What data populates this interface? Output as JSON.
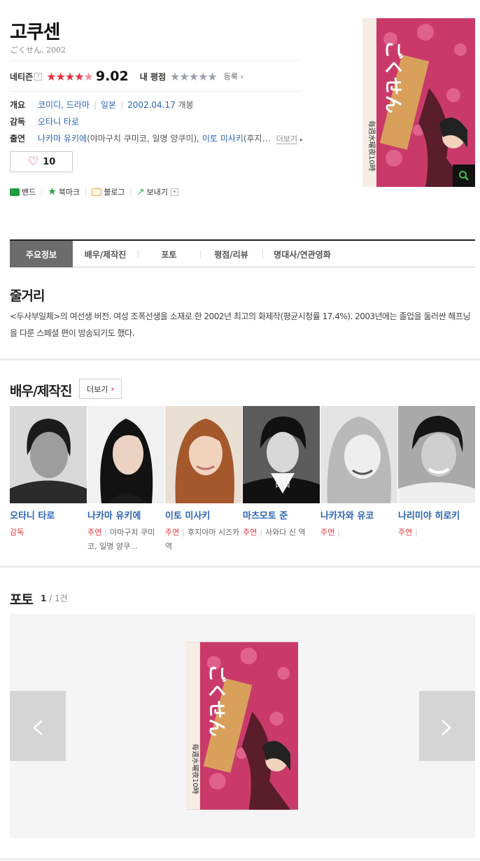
{
  "movie": {
    "title": "고쿠센",
    "original_title": "ごくせん, 2002"
  },
  "rating": {
    "netizen_label": "네티즌",
    "help_icon": "?",
    "netizen_stars": "★★★★",
    "netizen_half": "★",
    "netizen_score": "9.02",
    "netizen_score_value": 9.02,
    "my_label": "내 평점",
    "my_stars": "★★★★★",
    "register_label": "등록 ›"
  },
  "info": {
    "overview_label": "개요",
    "genre": "코미디, 드라마",
    "country": "일본",
    "release_date": "2002.04.17",
    "release_suffix": "개봉",
    "director_label": "감독",
    "director": "오타니 타로",
    "cast_label": "출연",
    "cast_1_name": "나카마 유키에",
    "cast_1_role": "(야마구치 쿠미코, 일명 양쿠미),",
    "cast_2_name": "이토 미사키",
    "cast_2_role": "(후지…",
    "more_label": "더보기",
    "more_arrow": "▸"
  },
  "like": {
    "heart": "♡",
    "count": "10"
  },
  "share": {
    "band": "밴드",
    "bookmark": "북마크",
    "blog": "블로그",
    "send": "보내기",
    "send_dropdown": "▾",
    "colors": {
      "band": "#1f9d3d",
      "bookmark": "#25a244",
      "blog": "#f0a23a",
      "send": "#2aa94a"
    }
  },
  "tabs": [
    {
      "label": "주요정보",
      "active": true
    },
    {
      "label": "배우/제작진"
    },
    {
      "label": "포토"
    },
    {
      "label": "평점/리뷰"
    },
    {
      "label": "명대사/연관영화"
    }
  ],
  "synopsis": {
    "title": "줄거리",
    "text": "<두사부일체>의 여선생 버전. 여성 조폭선생을 소재로 한 2002년 최고의 화제작(평균시청률 17.4%). 2003년에는 졸업을 둘러싼 해프닝을 다룬 스페셜 편이 방송되기도 했다."
  },
  "cast_section": {
    "title": "배우/제작진",
    "more_label": "더보기",
    "more_chevron": "›",
    "people": [
      {
        "name": "오타니 타로",
        "role": "감독",
        "character": ""
      },
      {
        "name": "나카마 유키에",
        "role": "주연",
        "character": "야마구치 쿠미코, 일명 양쿠..."
      },
      {
        "name": "이토 미사키",
        "role": "주연",
        "character": "후지야마 시즈카 역"
      },
      {
        "name": "마츠모토 준",
        "role": "주연",
        "character": "사와다 신 역"
      },
      {
        "name": "나카자와 유코",
        "role": "주연",
        "character": ""
      },
      {
        "name": "나리미야 히로키",
        "role": "주연",
        "character": ""
      }
    ],
    "separator": "|"
  },
  "photos": {
    "title": "포토",
    "current": "1",
    "total": " / 1건",
    "prev": "‹",
    "next": "›"
  },
  "poster": {
    "caption_1": "毎週水曜夜10時",
    "caption_2": "ごくせん",
    "zoom_icon": "🔍"
  },
  "colors": {
    "accent_red": "#e5333a",
    "link_blue": "#2c63b5",
    "tab_active": "#6c6c6c"
  }
}
